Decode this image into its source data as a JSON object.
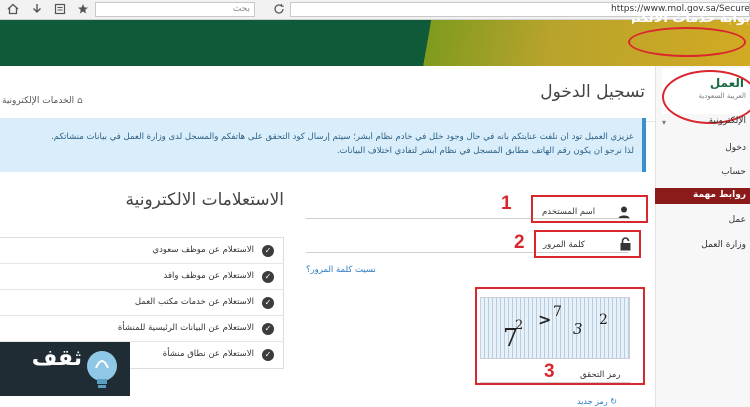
{
  "browser": {
    "url": "https://www.mol.gov.sa/SecureSSL/Lo",
    "search_placeholder": "بحث",
    "icons": [
      "home-icon",
      "download-icon",
      "bookmark-list-icon",
      "star-icon",
      "refresh-icon"
    ]
  },
  "banner": {
    "title": "بوابة خدمات الالكترونية",
    "colors": {
      "green": "#0e5a39",
      "gold": "#d2aa22"
    }
  },
  "sidebar": {
    "logo_title": "العمل",
    "logo_subtitle": "العربية السعودية",
    "items": [
      {
        "label": "الإلكترونية"
      },
      {
        "label": "دخول"
      },
      {
        "label": "حساب"
      },
      {
        "label": "روابط مهمة"
      },
      {
        "label": "عمل"
      },
      {
        "label": "وزارة العمل"
      }
    ]
  },
  "page": {
    "title": "تسجيل الدخول",
    "breadcrumb": "الخدمات الإلكترونية"
  },
  "notice": {
    "line1": "عزيزي العميل تود ان نلفت عنايتكم بأنه في حال وجود خلل في خادم نظام أبشر؛ سيتم إرسال كود التحقق على هاتفكم والمسجل لدى وزارة العمل في بيانات منشأتكم.",
    "line2": "لذا نرجو ان يكون رقم الهاتف مطابق المسجل في نظام أبشر لتفادي اختلاف البيانات."
  },
  "login": {
    "username_label": "اسم المستخدم",
    "password_label": "كلمة المرور",
    "forgot_password": "نسيت كلمة المرور؟",
    "captcha_label": "رمز التحقق",
    "captcha_chars": [
      "7",
      "2",
      ">",
      "7",
      "3",
      "2"
    ],
    "refresh_label": "رمز جديد",
    "annotations": [
      "1",
      "2",
      "3"
    ]
  },
  "inquiries": {
    "title": "الاستعلامات الالكترونية",
    "items": [
      {
        "label": "الاستعلام عن موظف سعودي"
      },
      {
        "label": "الاستعلام عن موظف وافد"
      },
      {
        "label": "الاستعلام عن خدمات مكتب العمل"
      },
      {
        "label": "الاستعلام عن البيانات الرئيسية للمنشأة"
      },
      {
        "label": "الاستعلام عن نطاق منشأة"
      }
    ]
  },
  "watermark": {
    "text": "ثقف"
  }
}
